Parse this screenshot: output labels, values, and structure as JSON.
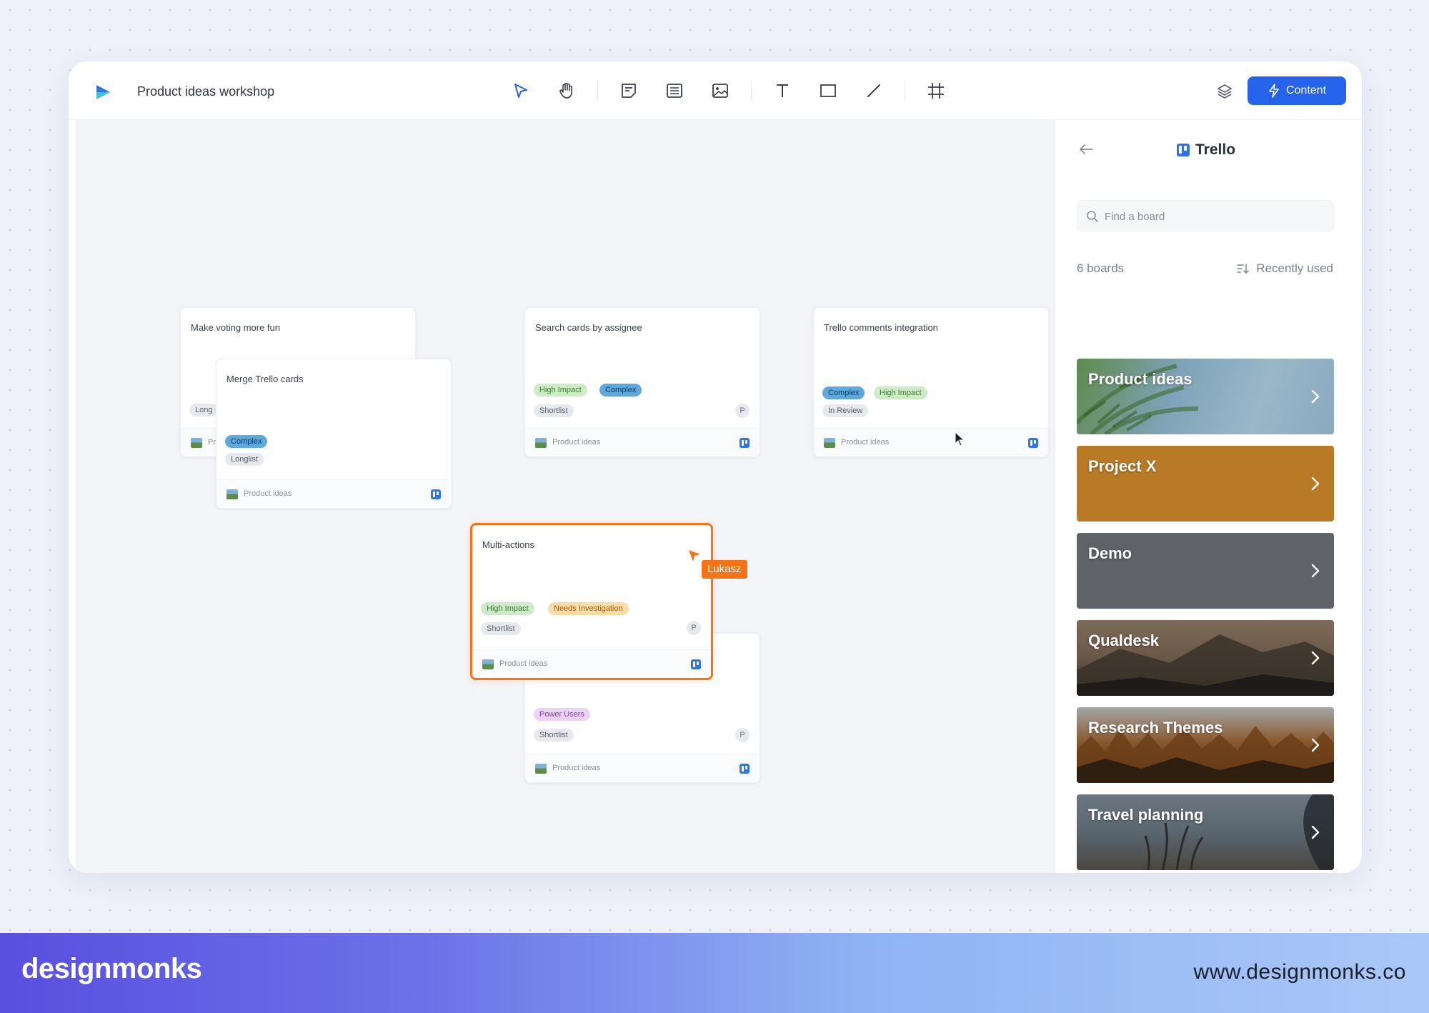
{
  "app": {
    "title": "Product ideas workshop",
    "content_button": "Content"
  },
  "cards": {
    "c1": {
      "title": "Make voting more fun",
      "tags": [
        "Long"
      ],
      "footer": "Pr"
    },
    "c2": {
      "title": "Merge Trello cards",
      "tags": [
        "Complex",
        "Longlist"
      ],
      "footer": "Product ideas"
    },
    "c3": {
      "title": "Search cards by assignee",
      "tags": [
        "High Impact",
        "Complex",
        "Shortlist"
      ],
      "avatar": "P",
      "footer": "Product ideas"
    },
    "c4": {
      "title": "Trello comments integration",
      "tags": [
        "Complex",
        "High Impact",
        "In Review"
      ],
      "footer": "Product ideas"
    },
    "c5": {
      "title": "Multi-actions",
      "tags": [
        "High Impact",
        "Needs Investigation",
        "Shortlist"
      ],
      "avatar": "P",
      "footer": "Product ideas"
    },
    "c6": {
      "tags": [
        "Power Users",
        "Shortlist"
      ],
      "avatar": "P",
      "footer": "Product ideas"
    }
  },
  "cursor_user": "Lukasz",
  "panel": {
    "title": "Trello",
    "search_placeholder": "Find a board",
    "board_count": "6 boards",
    "sort_label": "Recently used",
    "boards": [
      {
        "name": "Product ideas",
        "color": "#7ea3b8"
      },
      {
        "name": "Project X",
        "color": "#b97a26"
      },
      {
        "name": "Demo",
        "color": "#5f6267"
      },
      {
        "name": "Qualdesk",
        "color": "#6a5848"
      },
      {
        "name": "Research Themes",
        "color": "#8a5a2e"
      },
      {
        "name": "Travel planning",
        "color": "#5a6670"
      }
    ]
  },
  "banner": {
    "brand": "designmonks",
    "url": "www.designmonks.co"
  },
  "colors": {
    "accent": "#2563eb",
    "selection": "#f97316"
  }
}
